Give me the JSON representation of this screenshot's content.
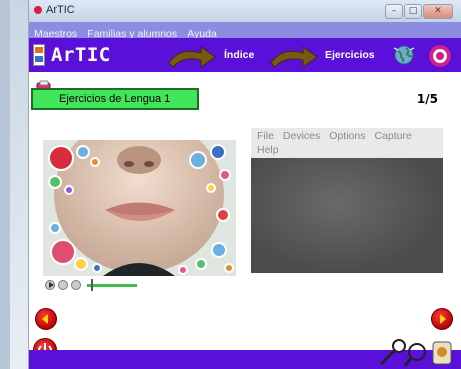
{
  "window": {
    "title": "ArTIC"
  },
  "menu": {
    "items": [
      "Maestros",
      "Familias y alumnos",
      "Ayuda"
    ]
  },
  "header": {
    "app_name": "ArTIC",
    "nav_index_label": "Índice",
    "nav_exercises_label": "Ejercicios"
  },
  "content": {
    "exercise_title": "Ejercicios de Lengua 1",
    "page_counter": "1/5",
    "video_menu": [
      "File",
      "Devices",
      "Options",
      "Capture",
      "Help"
    ]
  },
  "player": {
    "progress": 0.1
  },
  "colors": {
    "header_purple": "#5a10d8",
    "menu_lavender": "#8c8ce0",
    "label_green": "#41e55a",
    "nav_red": "#d40000"
  }
}
